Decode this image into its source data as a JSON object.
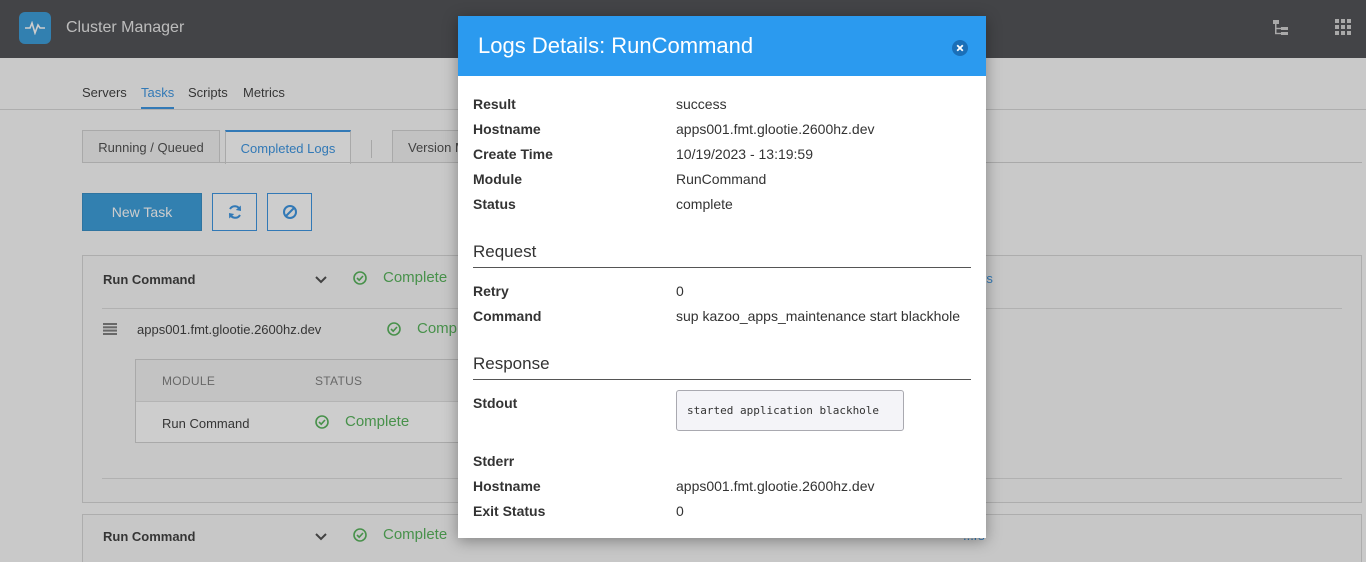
{
  "app": {
    "title": "Cluster Manager",
    "icon": "pulse-icon"
  },
  "topbar": {
    "icons": [
      "tree-icon",
      "apps-grid-icon"
    ]
  },
  "nav": {
    "items": [
      "Servers",
      "Tasks",
      "Scripts",
      "Metrics"
    ],
    "active": "Tasks"
  },
  "tabs": {
    "running": "Running / Queued",
    "completed": "Completed Logs",
    "version": "Version M"
  },
  "toolbar": {
    "new_task": "New Task",
    "refresh_icon": "refresh-icon",
    "cancel_icon": "ban-icon"
  },
  "cards": [
    {
      "title": "Run Command",
      "status": "Complete",
      "link_fragment": "rs",
      "server": {
        "host": "apps001.fmt.glootie.2600hz.dev",
        "status": "Comp"
      },
      "table": {
        "headers": [
          "MODULE",
          "STATUS"
        ],
        "row": {
          "module": "Run Command",
          "status": "Complete"
        }
      }
    },
    {
      "title": "Run Command",
      "status": "Complete",
      "link_fragment": "...rs"
    }
  ],
  "modal": {
    "title": "Logs Details: RunCommand",
    "summary": [
      {
        "label": "Result",
        "value": "success"
      },
      {
        "label": "Hostname",
        "value": "apps001.fmt.glootie.2600hz.dev"
      },
      {
        "label": "Create Time",
        "value": "10/19/2023 - 13:19:59"
      },
      {
        "label": "Module",
        "value": "RunCommand"
      },
      {
        "label": "Status",
        "value": "complete"
      }
    ],
    "request_title": "Request",
    "request": [
      {
        "label": "Retry",
        "value": "0"
      },
      {
        "label": "Command",
        "value": "sup kazoo_apps_maintenance start blackhole"
      }
    ],
    "response_title": "Response",
    "stdout_label": "Stdout",
    "stdout_value": "started application blackhole",
    "response": [
      {
        "label": "Stderr",
        "value": ""
      },
      {
        "label": "Hostname",
        "value": "apps001.fmt.glootie.2600hz.dev"
      },
      {
        "label": "Exit Status",
        "value": "0"
      }
    ]
  },
  "colors": {
    "accent": "#2b9aef",
    "success": "#4caf50",
    "topbar": "#46474b"
  }
}
